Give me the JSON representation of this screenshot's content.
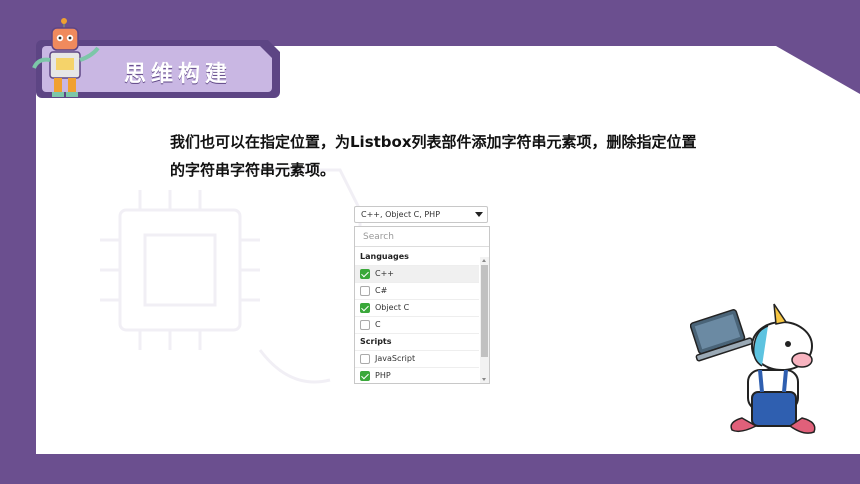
{
  "slide": {
    "title": "思维构建",
    "paragraph": "我们也可以在指定位置，为Listbox列表部件添加字符串元素项，删除指定位置的字符串字符串元素项。"
  },
  "dropdown": {
    "selected_value": "C++, Object C, PHP",
    "search_placeholder": "Search"
  },
  "listbox": {
    "groups": [
      {
        "label": "Languages",
        "items": [
          {
            "label": "C++",
            "checked": true
          },
          {
            "label": "C#",
            "checked": false
          },
          {
            "label": "Object C",
            "checked": true
          },
          {
            "label": "C",
            "checked": false
          }
        ]
      },
      {
        "label": "Scripts",
        "items": [
          {
            "label": "JavaScript",
            "checked": false
          },
          {
            "label": "PHP",
            "checked": true
          }
        ]
      }
    ]
  },
  "colors": {
    "background": "#6b4f8f",
    "accent_check": "#3aa83a",
    "banner": "#5d4584"
  },
  "icons": [
    "robot-mascot-icon",
    "unicorn-laptop-illustration",
    "chip-decoration-icon",
    "caret-down-icon",
    "checkmark-icon"
  ]
}
